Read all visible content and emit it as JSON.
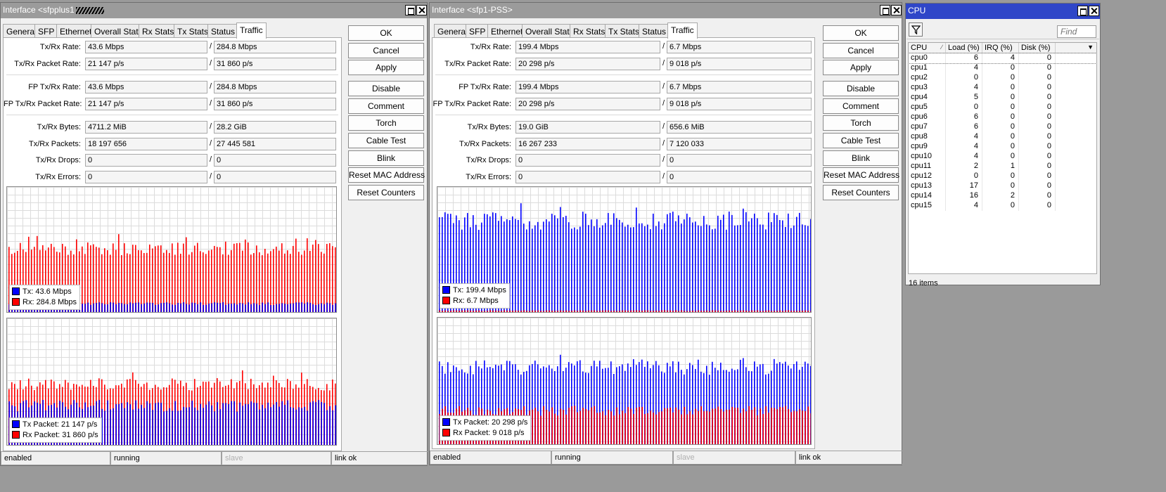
{
  "common": {
    "tabs": [
      "General",
      "SFP",
      "Ethernet",
      "Overall Stats",
      "Rx Stats",
      "Tx Stats",
      "Status",
      "Traffic"
    ],
    "labels": {
      "rate": "Tx/Rx Rate:",
      "packet_rate": "Tx/Rx Packet Rate:",
      "fp_rate": "FP Tx/Rx Rate:",
      "fp_packet_rate": "FP Tx/Rx Packet Rate:",
      "bytes": "Tx/Rx Bytes:",
      "packets": "Tx/Rx Packets:",
      "drops": "Tx/Rx Drops:",
      "errors": "Tx/Rx Errors:"
    },
    "slash": "/",
    "buttons": [
      "OK",
      "Cancel",
      "Apply",
      "Disable",
      "Comment",
      "Torch",
      "Cable Test",
      "Blink",
      "Reset MAC Address",
      "Reset Counters"
    ],
    "legend": {
      "tx": "Tx:",
      "rx": "Rx:",
      "tx_packet": "Tx Packet:",
      "rx_packet": "Rx Packet:"
    },
    "colors": {
      "tx": "#0000ff",
      "rx": "#ff0000",
      "title_active": "#2f46c8",
      "title_inactive": "#9b9b9b"
    }
  },
  "win1": {
    "title": "Interface <sfpplus1",
    "selected_tab": "Traffic",
    "values": {
      "rate": [
        "43.6 Mbps",
        "284.8 Mbps"
      ],
      "packet_rate": [
        "21 147 p/s",
        "31 860 p/s"
      ],
      "fp_rate": [
        "43.6 Mbps",
        "284.8 Mbps"
      ],
      "fp_packet_rate": [
        "21 147 p/s",
        "31 860 p/s"
      ],
      "bytes": [
        "4711.2 MiB",
        "28.2 GiB"
      ],
      "packets": [
        "18 197 656",
        "27 445 581"
      ],
      "drops": [
        "0",
        "0"
      ],
      "errors": [
        "0",
        "0"
      ]
    },
    "legend_values": {
      "tx": "43.6 Mbps",
      "rx": "284.8 Mbps",
      "tx_packet": "21 147 p/s",
      "rx_packet": "31 860 p/s"
    },
    "status": [
      "enabled",
      "running",
      "slave",
      "link ok"
    ]
  },
  "win2": {
    "title": "Interface <sfp1-PSS>",
    "selected_tab": "Traffic",
    "values": {
      "rate": [
        "199.4 Mbps",
        "6.7 Mbps"
      ],
      "packet_rate": [
        "20 298 p/s",
        "9 018 p/s"
      ],
      "fp_rate": [
        "199.4 Mbps",
        "6.7 Mbps"
      ],
      "fp_packet_rate": [
        "20 298 p/s",
        "9 018 p/s"
      ],
      "bytes": [
        "19.0 GiB",
        "656.6 MiB"
      ],
      "packets": [
        "16 267 233",
        "7 120 033"
      ],
      "drops": [
        "0",
        "0"
      ],
      "errors": [
        "0",
        "0"
      ]
    },
    "legend_values": {
      "tx": "199.4 Mbps",
      "rx": "6.7 Mbps",
      "tx_packet": "20 298 p/s",
      "rx_packet": "9 018 p/s"
    },
    "status": [
      "enabled",
      "running",
      "slave",
      "link ok"
    ]
  },
  "cpu": {
    "title": "CPU",
    "find_placeholder": "Find",
    "columns": [
      "CPU",
      "Load (%)",
      "IRQ (%)",
      "Disk (%)"
    ],
    "rows": [
      {
        "cpu": "cpu0",
        "load": "6",
        "irq": "4",
        "disk": "0"
      },
      {
        "cpu": "cpu1",
        "load": "4",
        "irq": "0",
        "disk": "0"
      },
      {
        "cpu": "cpu2",
        "load": "0",
        "irq": "0",
        "disk": "0"
      },
      {
        "cpu": "cpu3",
        "load": "4",
        "irq": "0",
        "disk": "0"
      },
      {
        "cpu": "cpu4",
        "load": "5",
        "irq": "0",
        "disk": "0"
      },
      {
        "cpu": "cpu5",
        "load": "0",
        "irq": "0",
        "disk": "0"
      },
      {
        "cpu": "cpu6",
        "load": "6",
        "irq": "0",
        "disk": "0"
      },
      {
        "cpu": "cpu7",
        "load": "6",
        "irq": "0",
        "disk": "0"
      },
      {
        "cpu": "cpu8",
        "load": "4",
        "irq": "0",
        "disk": "0"
      },
      {
        "cpu": "cpu9",
        "load": "4",
        "irq": "0",
        "disk": "0"
      },
      {
        "cpu": "cpu10",
        "load": "4",
        "irq": "0",
        "disk": "0"
      },
      {
        "cpu": "cpu11",
        "load": "2",
        "irq": "1",
        "disk": "0"
      },
      {
        "cpu": "cpu12",
        "load": "0",
        "irq": "0",
        "disk": "0"
      },
      {
        "cpu": "cpu13",
        "load": "17",
        "irq": "0",
        "disk": "0"
      },
      {
        "cpu": "cpu14",
        "load": "16",
        "irq": "2",
        "disk": "0"
      },
      {
        "cpu": "cpu15",
        "load": "4",
        "irq": "0",
        "disk": "0"
      }
    ],
    "count_label": "16 items"
  }
}
